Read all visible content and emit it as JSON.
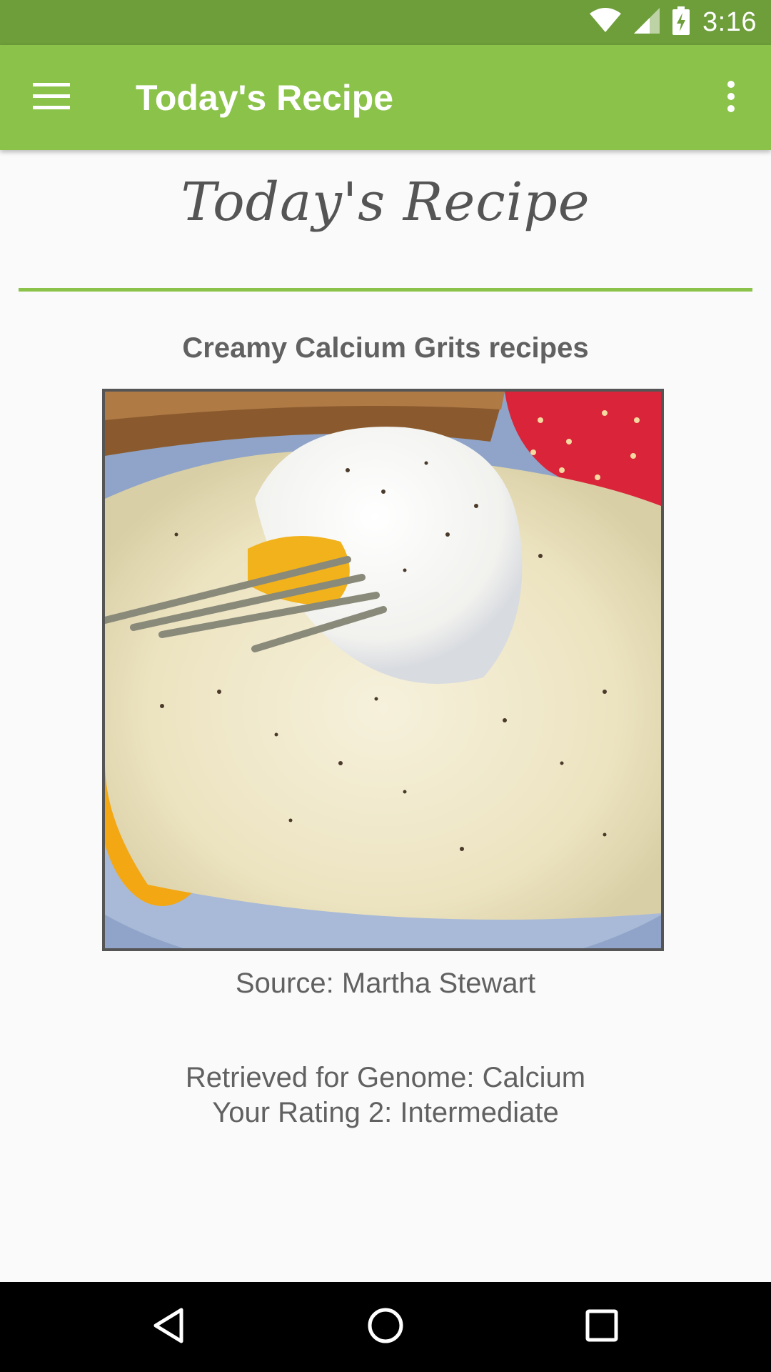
{
  "status_bar": {
    "time": "3:16",
    "icons": [
      "wifi-icon",
      "cell-signal-icon",
      "battery-charging-icon"
    ]
  },
  "app_bar": {
    "title": "Today's Recipe",
    "menu_icon": "hamburger-menu-icon",
    "overflow_icon": "more-vert-icon"
  },
  "content": {
    "heading": "Today's Recipe",
    "recipe_name": "Creamy Calcium Grits recipes",
    "image_alt": "Creamy grits with a poached egg, fork, toast and strawberry",
    "source": "Source: Martha Stewart",
    "genome_line": "Retrieved for Genome: Calcium",
    "rating_line": "Your Rating 2: Intermediate"
  },
  "nav_bar": {
    "back_icon": "back-triangle-icon",
    "home_icon": "home-circle-icon",
    "recents_icon": "recents-square-icon"
  },
  "colors": {
    "status_bar": "#6d9e3a",
    "app_bar": "#8bc34a",
    "divider": "#8bc34a",
    "text": "#616161"
  }
}
